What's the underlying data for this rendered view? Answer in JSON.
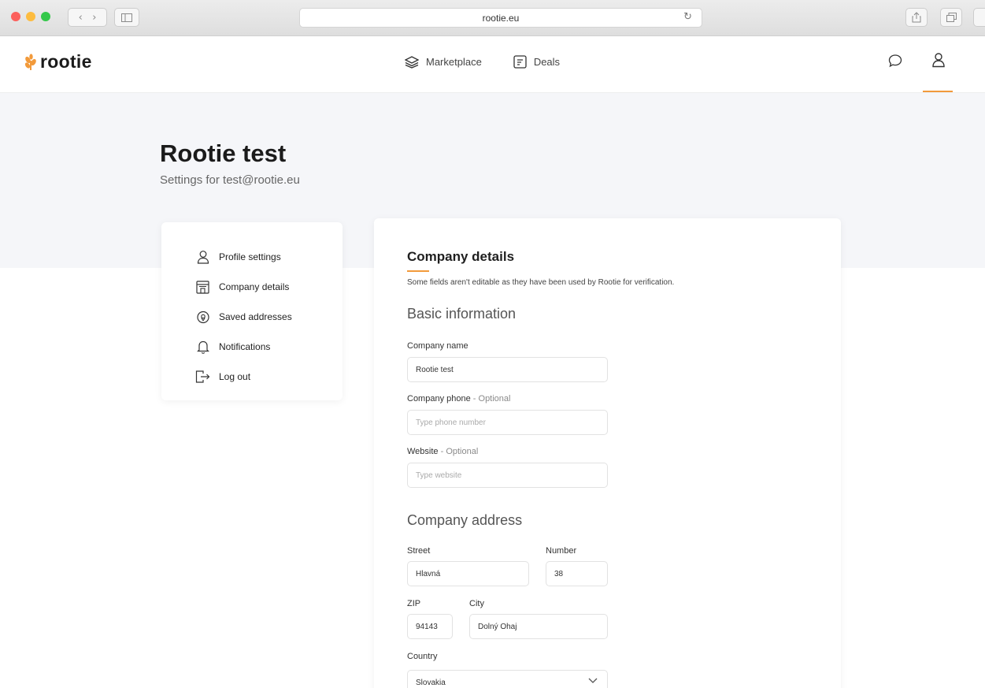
{
  "browser": {
    "url": "rootie.eu",
    "colors": {
      "close": "#fc605c",
      "minimize": "#fdbc40",
      "maximize": "#34c84a"
    }
  },
  "header": {
    "logo_text": "rootie",
    "nav": [
      {
        "label": "Marketplace",
        "icon": "layers-icon"
      },
      {
        "label": "Deals",
        "icon": "deals-icon"
      }
    ],
    "accent": "#f29a3b"
  },
  "page": {
    "title": "Rootie test",
    "subtitle": "Settings for test@rootie.eu"
  },
  "sidebar": {
    "items": [
      {
        "label": "Profile settings",
        "icon": "user-icon"
      },
      {
        "label": "Company details",
        "icon": "building-icon"
      },
      {
        "label": "Saved addresses",
        "icon": "location-pin-icon"
      },
      {
        "label": "Notifications",
        "icon": "bell-icon"
      },
      {
        "label": "Log out",
        "icon": "logout-icon"
      }
    ]
  },
  "main": {
    "title": "Company details",
    "notice": "Some fields aren't editable as they have been used by Rootie for verification.",
    "basic": {
      "heading": "Basic information",
      "company_name_label": "Company name",
      "company_name_value": "Rootie test",
      "phone_label": "Company phone",
      "phone_optional": " - Optional",
      "phone_placeholder": "Type phone number",
      "website_label": "Website",
      "website_optional": " - Optional",
      "website_placeholder": "Type website"
    },
    "address": {
      "heading": "Company address",
      "street_label": "Street",
      "street_value": "Hlavná",
      "number_label": "Number",
      "number_value": "38",
      "zip_label": "ZIP",
      "zip_value": "94143",
      "city_label": "City",
      "city_value": "Dolný Ohaj",
      "country_label": "Country",
      "country_value": "Slovakia"
    }
  }
}
